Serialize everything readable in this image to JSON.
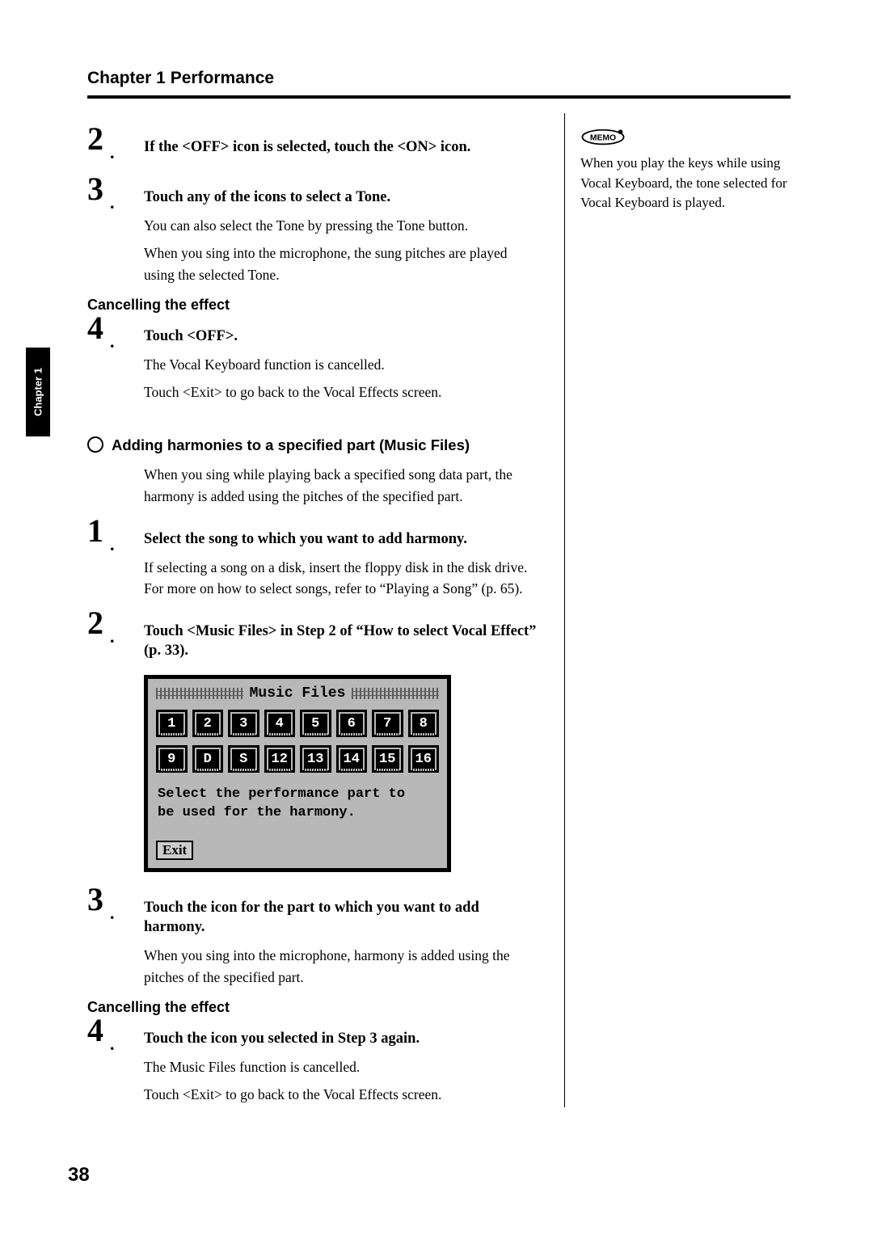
{
  "header": "Chapter 1 Performance",
  "sideTab": "Chapter 1",
  "memo": "When you play the keys while using Vocal Keyboard, the tone selected for Vocal Keyboard is played.",
  "s2": {
    "num": "2",
    "head": "If the <OFF> icon is selected, touch the <ON> icon."
  },
  "s3": {
    "num": "3",
    "head": "Touch any of the icons to select a Tone.",
    "p1": "You can also select the Tone by pressing the Tone button.",
    "p2": "When you sing into the microphone, the sung pitches are played using the selected Tone."
  },
  "cancel1": "Cancelling the effect",
  "s4": {
    "num": "4",
    "head": "Touch <OFF>.",
    "p1": "The Vocal Keyboard function is cancelled.",
    "p2": "Touch <Exit> to go back to the Vocal Effects screen."
  },
  "sectionA": {
    "title": "Adding harmonies to a specified part (Music Files)",
    "body": "When you sing while playing back a specified song data part, the harmony is added using the pitches of the specified part."
  },
  "a1": {
    "num": "1",
    "head": "Select the song to which you want to add harmony.",
    "p1": "If selecting a song on a disk, insert the floppy disk in the disk drive. For more on how to select songs, refer to “Playing a Song” (p. 65)."
  },
  "a2": {
    "num": "2",
    "head": "Touch <Music Files> in Step 2 of “How to select Vocal Effect” (p. 33)."
  },
  "screen": {
    "title": "Music Files",
    "row1": [
      "1",
      "2",
      "3",
      "4",
      "5",
      "6",
      "7",
      "8"
    ],
    "row2": [
      "9",
      "D",
      "S",
      "12",
      "13",
      "14",
      "15",
      "16"
    ],
    "msg1": "Select the performance part to",
    "msg2": "be used for the harmony.",
    "exit": "Exit"
  },
  "a3": {
    "num": "3",
    "head": "Touch the icon for the part to which you want to add harmony.",
    "p1": "When you sing into the microphone, harmony is added using the pitches of the specified part."
  },
  "cancel2": "Cancelling the effect",
  "a4": {
    "num": "4",
    "head": "Touch the icon you selected in Step 3 again.",
    "p1": "The Music Files function is cancelled.",
    "p2": "Touch <Exit> to go back to the Vocal Effects screen."
  },
  "pageNum": "38"
}
